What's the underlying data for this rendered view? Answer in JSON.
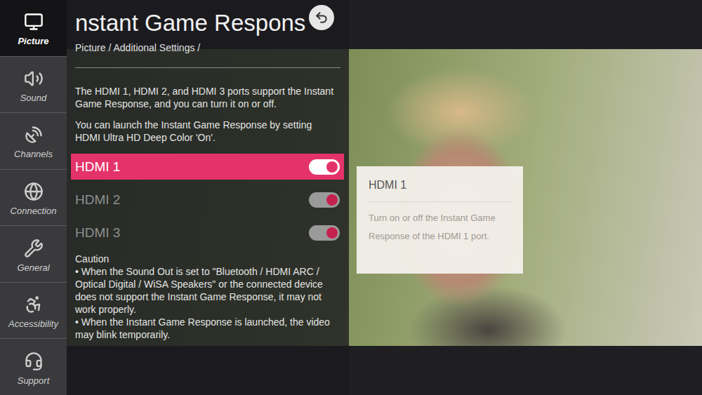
{
  "sidebar": {
    "items": [
      {
        "label": "Picture",
        "selected": true
      },
      {
        "label": "Sound",
        "selected": false
      },
      {
        "label": "Channels",
        "selected": false
      },
      {
        "label": "Connection",
        "selected": false
      },
      {
        "label": "General",
        "selected": false
      },
      {
        "label": "Accessibility",
        "selected": false
      },
      {
        "label": "Support",
        "selected": false
      }
    ]
  },
  "header": {
    "title": "nstant Game Respons"
  },
  "breadcrumb": "Picture / Additional Settings /",
  "description": [
    "The HDMI 1, HDMI 2, and HDMI 3 ports support the Instant Game Response, and you can turn it on or off.",
    "You can launch the Instant Game Response by setting HDMI Ultra HD Deep Color 'On'."
  ],
  "ports": [
    {
      "label": "HDMI 1",
      "on": true,
      "selected": true
    },
    {
      "label": "HDMI 2",
      "on": true,
      "selected": false
    },
    {
      "label": "HDMI 3",
      "on": true,
      "selected": false
    }
  ],
  "tooltip": {
    "title": "HDMI 1",
    "text": "Turn on or off the Instant Game Response of the HDMI 1 port."
  },
  "caution": {
    "title": "Caution",
    "items": [
      "• When the Sound Out is set to \"Bluetooth / HDMI ARC / Optical Digital / WiSA Speakers\" or the connected device does not support the Instant Game Response, it may not work properly.",
      "• When the Instant Game Response is launched, the video may blink temporarily."
    ]
  }
}
